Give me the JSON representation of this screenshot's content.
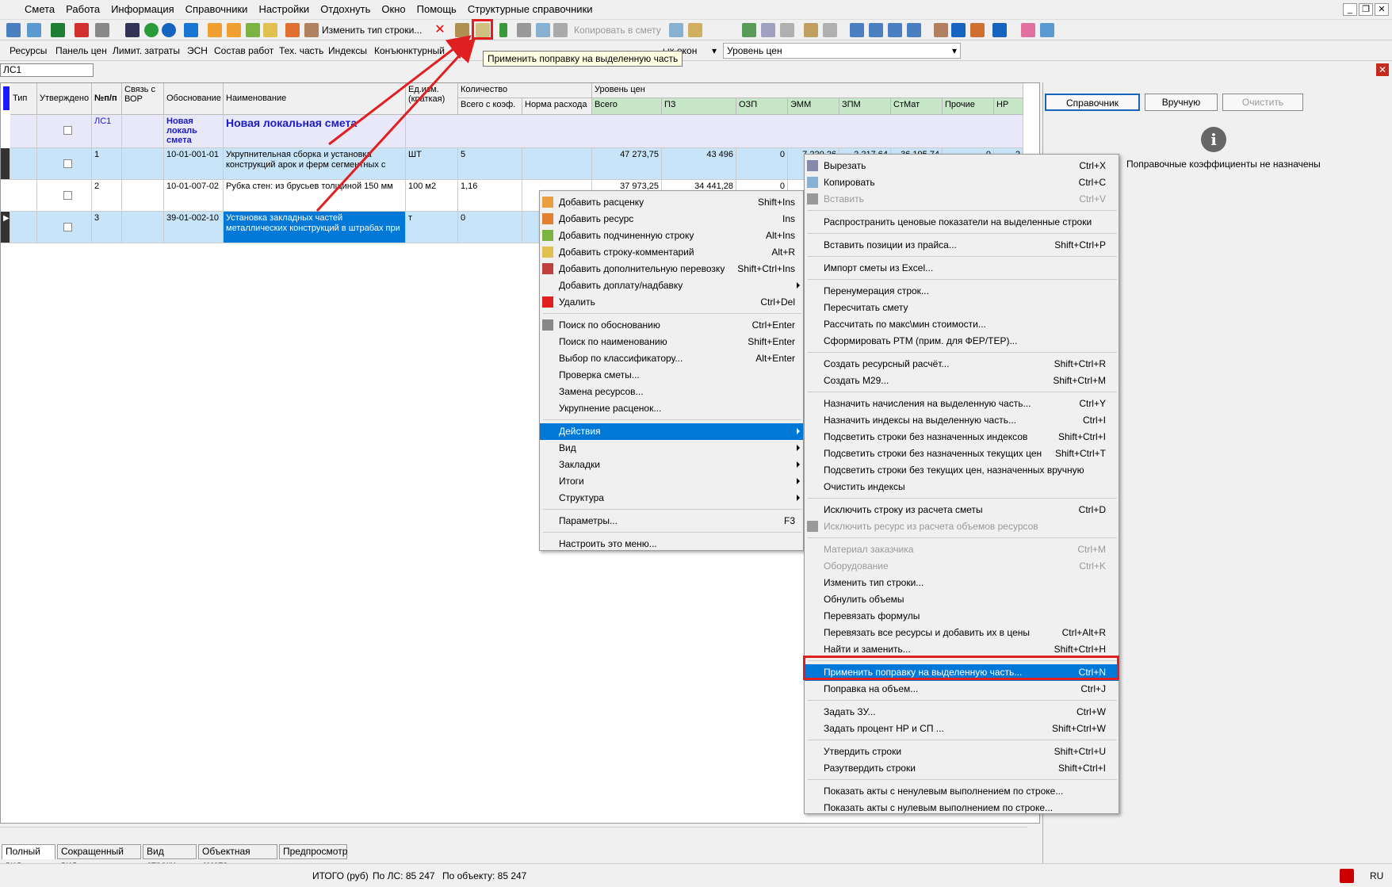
{
  "menu": [
    "Смета",
    "Работа",
    "Информация",
    "Справочники",
    "Настройки",
    "Отдохнуть",
    "Окно",
    "Помощь",
    "Структурные справочники"
  ],
  "toolbar1": {
    "change_type": "Изменить тип строки...",
    "copy_to_smeta": "Копировать в смету"
  },
  "toolbar2": [
    "Ресурсы",
    "Панель цен",
    "Лимит. затраты",
    "ЭСН",
    "Состав работ",
    "Тех. часть",
    "Индексы",
    "Конъюнктурный",
    "П",
    "ых окон"
  ],
  "level_select": "Уровень цен",
  "tooltip": "Применить поправку на выделенную часть",
  "address": "ЛС1",
  "grid": {
    "headers": {
      "type": "Тип",
      "approved": "Утверждено",
      "num": "№п/п",
      "link": "Связь с ВОР",
      "basis": "Обоснование",
      "name": "Наименование",
      "unit": "Ед.изм. (краткая)",
      "qty": "Количество",
      "qty_total": "Всего с коэф.",
      "qty_norm": "Норма расхода",
      "level": "Уровень цен",
      "total": "Всего",
      "pz": "ПЗ",
      "ozp": "ОЗП",
      "emm": "ЭММ",
      "zpm": "ЗПМ",
      "stmat": "СтМат",
      "other": "Прочие",
      "np": "НР"
    },
    "rows": [
      {
        "num": "ЛС1",
        "basis": "Новая локаль смета",
        "name": "Новая локальная смета",
        "unit": "",
        "qty": "",
        "total": "",
        "pz": "",
        "ozp": "",
        "emm": "",
        "zpm": "",
        "stmat": "",
        "other": "",
        "np": ""
      },
      {
        "num": "1",
        "basis": "10-01-001-01",
        "name": "Укрупнительная сборка и установка конструкций арок и ферм сегментных с",
        "unit": "ШТ",
        "qty": "5",
        "total": "47 273,75",
        "pz": "43 496",
        "ozp": "0",
        "emm": "7 220,26",
        "zpm": "2 217,64",
        "stmat": "36 195,74",
        "other": "0",
        "np": "2"
      },
      {
        "num": "2",
        "basis": "10-01-007-02",
        "name": "Рубка стен: из брусьев толщиной 150 мм",
        "unit": "100 м2",
        "qty": "1,16",
        "total": "37 973,25",
        "pz": "34 441,28",
        "ozp": "0",
        "emm": "",
        "zpm": "",
        "stmat": "",
        "other": "",
        "np": ""
      },
      {
        "num": "3",
        "basis": "39-01-002-10",
        "name": "Установка закладных частей металлических конструкций в штрабах при",
        "unit": "т",
        "qty": "0",
        "total": "",
        "pz": "",
        "ozp": "",
        "emm": "",
        "zpm": "",
        "stmat": "",
        "other": "",
        "np": ""
      }
    ]
  },
  "right_panel": {
    "btn_ref": "Справочник",
    "btn_manual": "Вручную",
    "btn_clear": "Очистить",
    "no_coef": "Поправочные коэффициенты не назначены"
  },
  "ctx1": [
    {
      "label": "Добавить расценку",
      "sc": "Shift+Ins"
    },
    {
      "label": "Добавить ресурс",
      "sc": "Ins"
    },
    {
      "label": "Добавить подчиненную строку",
      "sc": "Alt+Ins"
    },
    {
      "label": "Добавить строку-комментарий",
      "sc": "Alt+R"
    },
    {
      "label": "Добавить дополнительную перевозку",
      "sc": "Shift+Ctrl+Ins"
    },
    {
      "label": "Добавить доплату/надбавку",
      "sc": ""
    },
    {
      "label": "Удалить",
      "sc": "Ctrl+Del"
    },
    {
      "label": "Поиск по обоснованию",
      "sc": "Ctrl+Enter"
    },
    {
      "label": "Поиск по наименованию",
      "sc": "Shift+Enter"
    },
    {
      "label": "Выбор по классификатору...",
      "sc": "Alt+Enter"
    },
    {
      "label": "Проверка сметы...",
      "sc": ""
    },
    {
      "label": "Замена ресурсов...",
      "sc": ""
    },
    {
      "label": "Укрупнение расценок...",
      "sc": ""
    },
    {
      "label": "Действия",
      "sc": ""
    },
    {
      "label": "Вид",
      "sc": ""
    },
    {
      "label": "Закладки",
      "sc": ""
    },
    {
      "label": "Итоги",
      "sc": ""
    },
    {
      "label": "Структура",
      "sc": ""
    },
    {
      "label": "Параметры...",
      "sc": "F3"
    },
    {
      "label": "Настроить это меню...",
      "sc": ""
    }
  ],
  "ctx2": [
    {
      "label": "Вырезать",
      "sc": "Ctrl+X"
    },
    {
      "label": "Копировать",
      "sc": "Ctrl+C"
    },
    {
      "label": "Вставить",
      "sc": "Ctrl+V"
    },
    {
      "label": "Распространить ценовые показатели на выделенные строки",
      "sc": ""
    },
    {
      "label": "Вставить позиции из прайса...",
      "sc": "Shift+Ctrl+P"
    },
    {
      "label": "Импорт сметы из Excel...",
      "sc": ""
    },
    {
      "label": "Перенумерация строк...",
      "sc": ""
    },
    {
      "label": "Пересчитать смету",
      "sc": ""
    },
    {
      "label": "Рассчитать по макс\\мин стоимости...",
      "sc": ""
    },
    {
      "label": "Сформировать РТМ (прим. для ФЕР/ТЕР)...",
      "sc": ""
    },
    {
      "label": "Создать ресурсный расчёт...",
      "sc": "Shift+Ctrl+R"
    },
    {
      "label": "Создать М29...",
      "sc": "Shift+Ctrl+M"
    },
    {
      "label": "Назначить начисления на выделенную часть...",
      "sc": "Ctrl+Y"
    },
    {
      "label": "Назначить индексы на выделенную часть...",
      "sc": "Ctrl+I"
    },
    {
      "label": "Подсветить строки без назначенных индексов",
      "sc": "Shift+Ctrl+I"
    },
    {
      "label": "Подсветить строки без назначенных текущих цен",
      "sc": "Shift+Ctrl+T"
    },
    {
      "label": "Подсветить строки без текущих цен, назначенных вручную",
      "sc": ""
    },
    {
      "label": "Очистить индексы",
      "sc": ""
    },
    {
      "label": "Исключить строку из расчета сметы",
      "sc": "Ctrl+D"
    },
    {
      "label": "Исключить ресурс из расчета объемов ресурсов",
      "sc": ""
    },
    {
      "label": "Материал заказчика",
      "sc": "Ctrl+M"
    },
    {
      "label": "Оборудование",
      "sc": "Ctrl+K"
    },
    {
      "label": "Изменить тип строки...",
      "sc": ""
    },
    {
      "label": "Обнулить объемы",
      "sc": ""
    },
    {
      "label": "Перевязать формулы",
      "sc": ""
    },
    {
      "label": "Перевязать все ресурсы и добавить их в цены",
      "sc": "Ctrl+Alt+R"
    },
    {
      "label": "Найти и заменить...",
      "sc": "Shift+Ctrl+H"
    },
    {
      "label": "Применить поправку на выделенную часть...",
      "sc": "Ctrl+N"
    },
    {
      "label": "Поправка на объем...",
      "sc": "Ctrl+J"
    },
    {
      "label": "Задать ЗУ...",
      "sc": "Ctrl+W"
    },
    {
      "label": "Задать процент НР и СП ...",
      "sc": "Shift+Ctrl+W"
    },
    {
      "label": "Утвердить строки",
      "sc": "Shift+Ctrl+U"
    },
    {
      "label": "Разутвердить строки",
      "sc": "Shift+Ctrl+I"
    },
    {
      "label": "Показать акты с ненулевым выполнением по строке...",
      "sc": ""
    },
    {
      "label": "Показать акты с нулевым выполнением по строке...",
      "sc": ""
    }
  ],
  "tabs": [
    "Полный вид",
    "Сокращенный вид",
    "Вид строки",
    "Объектная смета",
    "Предпросмотр"
  ],
  "status": {
    "total": "ИТОГО (руб)",
    "by_ls": "По ЛС: 85 247",
    "by_obj": "По объекту: 85 247",
    "lang": "RU"
  }
}
